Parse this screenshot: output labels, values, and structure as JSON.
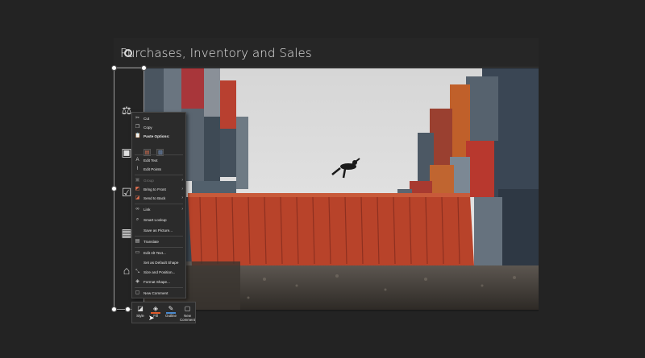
{
  "slide": {
    "title": "Purchases, Inventory and Sales"
  },
  "side_icons": [
    "scales-icon",
    "forklift-icon",
    "handshake-check-icon",
    "shelves-icon",
    "warehouse-icon"
  ],
  "context_menu": {
    "items": [
      {
        "label": "Cut",
        "icon": "scissors-icon"
      },
      {
        "label": "Copy",
        "icon": "copy-icon"
      },
      {
        "label": "Paste Options:",
        "icon": "paste-icon"
      },
      {
        "label": "Edit Text",
        "icon": "edit-text-icon"
      },
      {
        "label": "Edit Points",
        "icon": "edit-points-icon"
      },
      {
        "label": "Group",
        "icon": "group-icon",
        "disabled": true
      },
      {
        "label": "Bring to Front",
        "icon": "bring-front-icon"
      },
      {
        "label": "Send to Back",
        "icon": "send-back-icon"
      },
      {
        "label": "Link",
        "icon": "link-icon"
      },
      {
        "label": "Smart Lookup",
        "icon": "search-icon"
      },
      {
        "label": "Save as Picture...",
        "icon": ""
      },
      {
        "label": "Translate",
        "icon": "translate-icon"
      },
      {
        "label": "Edit Alt Text...",
        "icon": "alt-text-icon"
      },
      {
        "label": "Set as Default Shape",
        "icon": ""
      },
      {
        "label": "Size and Position...",
        "icon": "size-icon"
      },
      {
        "label": "Format Shape...",
        "icon": "format-icon"
      },
      {
        "label": "New Comment",
        "icon": "comment-icon"
      }
    ]
  },
  "mini_toolbar": {
    "style": "Style",
    "fill": "Fill",
    "outline": "Outline",
    "new_comment": "New Comment"
  },
  "colors": {
    "accent_fill": "#e05a2a",
    "accent_outline": "#4a8ad0",
    "container_red": "#b8432a"
  }
}
